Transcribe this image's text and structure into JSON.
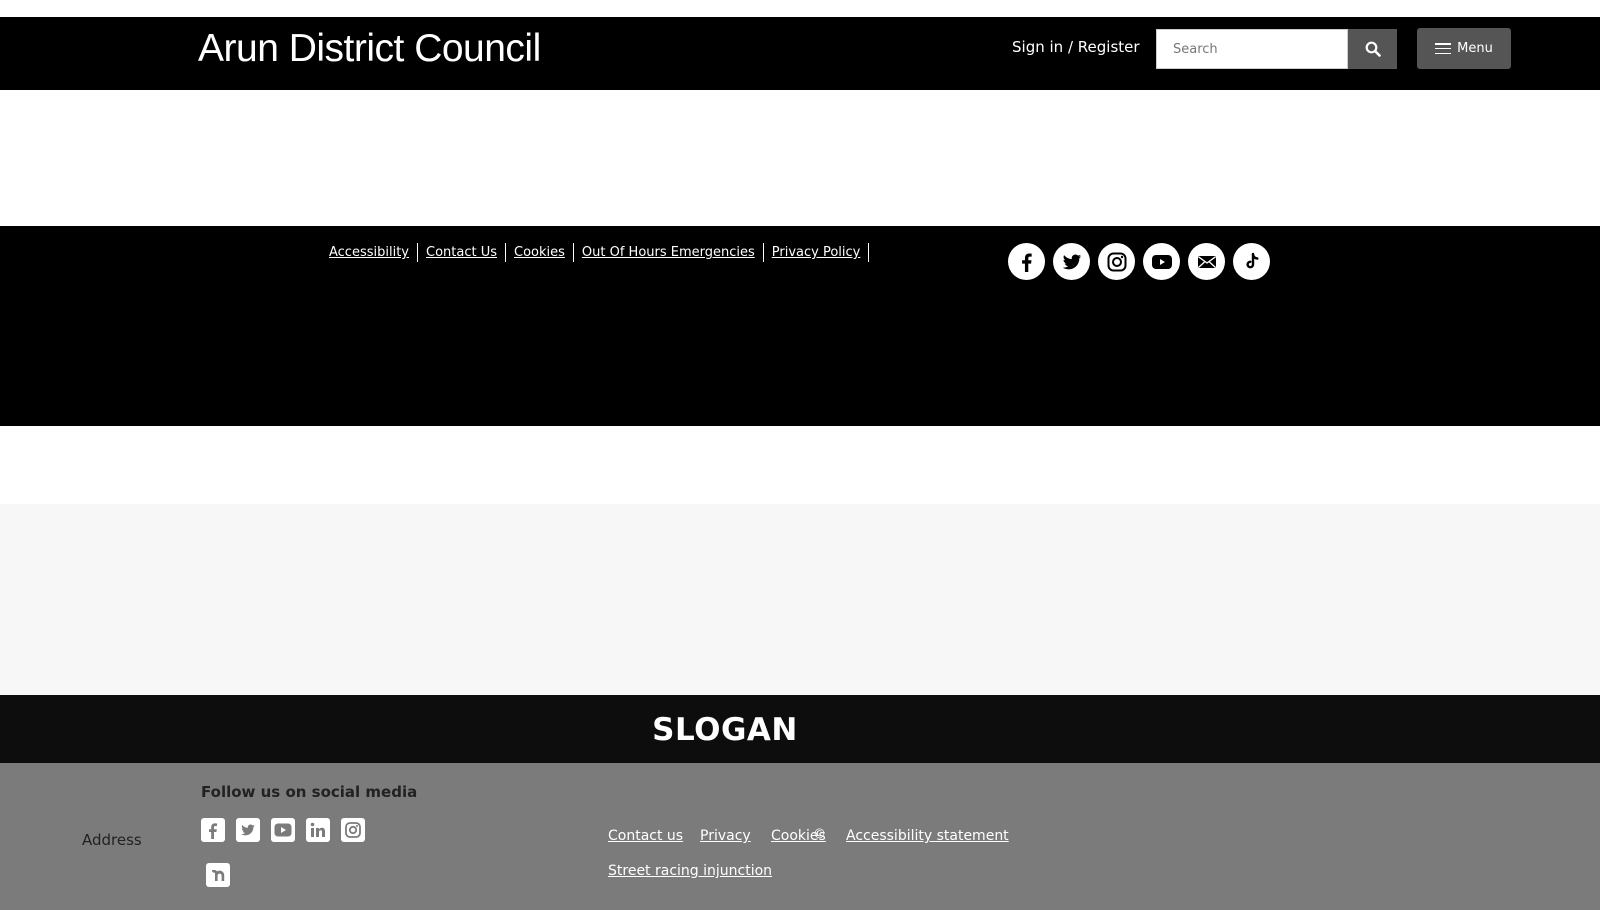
{
  "header": {
    "title": "Arun District Council",
    "signin": "Sign in",
    "separator": "/",
    "register": "Register",
    "search_placeholder": "Search",
    "menu_label": "Menu"
  },
  "footer": {
    "links": [
      "Accessibility",
      "Contact Us",
      "Cookies",
      "Out Of Hours Emergencies",
      "Privacy Policy"
    ],
    "social_icons": [
      "facebook-icon",
      "twitter-icon",
      "instagram-icon",
      "youtube-icon",
      "email-icon",
      "tiktok-icon"
    ]
  },
  "slogan": "SLOGAN",
  "bottom": {
    "follow_heading": "Follow us on social media",
    "address_label": "Address",
    "social_icons": [
      "facebook-icon",
      "twitter-icon",
      "youtube-icon",
      "linkedin-icon",
      "instagram-icon",
      "nextdoor-icon"
    ],
    "links": [
      "Contact us",
      "Privacy",
      "Cookies",
      "Accessibility statement",
      "Street racing injunction"
    ],
    "copyright_symbol": "©"
  },
  "colors": {
    "header_bg": "#000000",
    "button_bg": "#555555",
    "panel_bg": "#f7f7f7",
    "slogan_bg": "#0d0d0d",
    "bottom_bg": "#7b7b7b"
  }
}
